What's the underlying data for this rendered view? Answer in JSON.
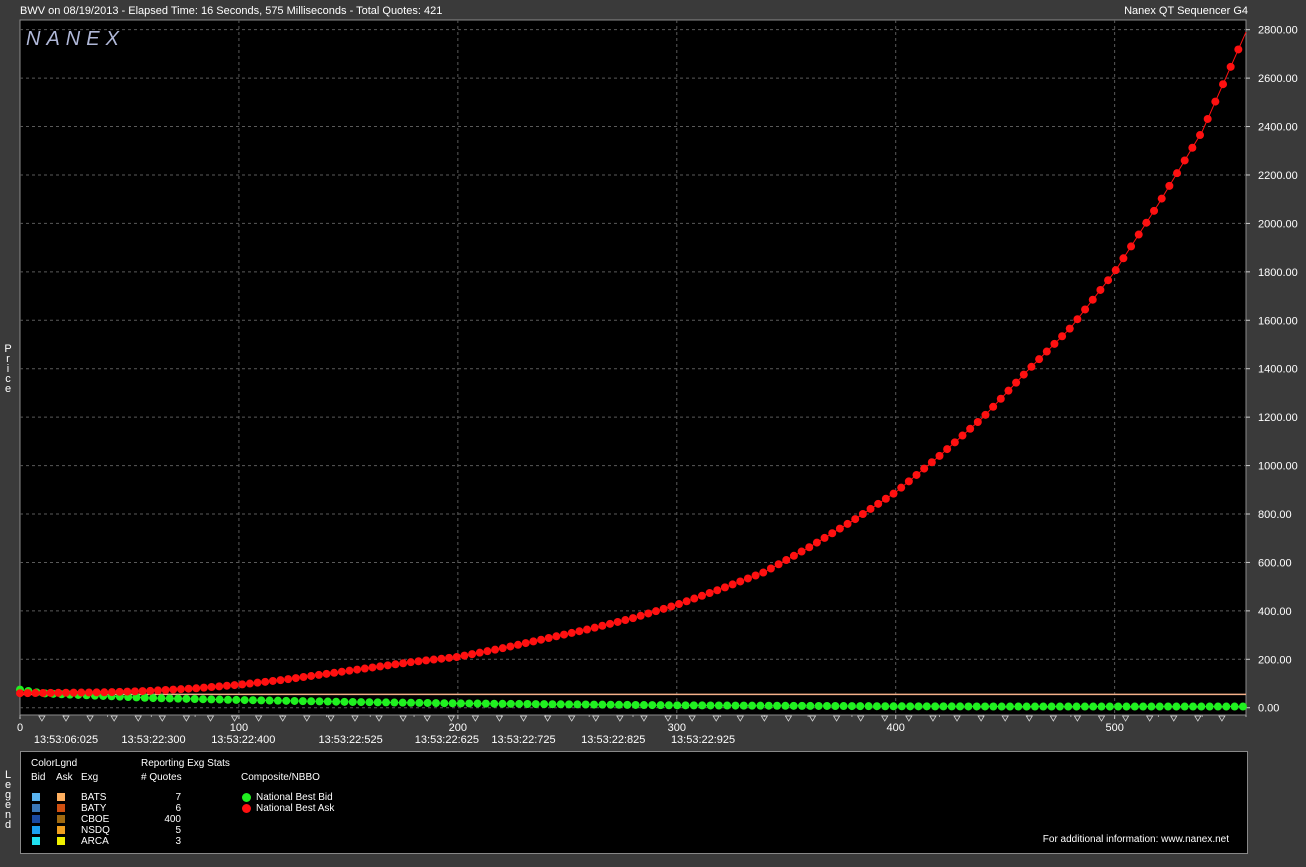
{
  "header": {
    "title": "BWV on 08/19/2013  -  Elapsed Time: 16 Seconds, 575 Milliseconds  -  Total Quotes: 421",
    "app_name": "Nanex QT Sequencer G4"
  },
  "watermark": "NANEX",
  "y_axis_label": "Price",
  "legend_side_label": "Legend",
  "chart_data": {
    "type": "scatter",
    "xlim": [
      0,
      560
    ],
    "ylim": [
      -30,
      2840
    ],
    "y_ticks": [
      0,
      200,
      400,
      600,
      800,
      1000,
      1200,
      1400,
      1600,
      1800,
      2000,
      2200,
      2400,
      2600,
      2800
    ],
    "y_tick_labels": [
      "0.00",
      "200.00",
      "400.00",
      "600.00",
      "800.00",
      "1000.00",
      "1200.00",
      "1400.00",
      "1600.00",
      "1800.00",
      "2000.00",
      "2200.00",
      "2400.00",
      "2600.00",
      "2800.00"
    ],
    "x_ticks": [
      0,
      100,
      200,
      300,
      400,
      500
    ],
    "x_tick_labels": [
      "0",
      "100",
      "200",
      "300",
      "400",
      "500"
    ],
    "time_labels": [
      {
        "x": 21,
        "label": "13:53:06:025"
      },
      {
        "x": 61,
        "label": "13:53:22:300"
      },
      {
        "x": 102,
        "label": "13:53:22:400"
      },
      {
        "x": 151,
        "label": "13:53:22:525"
      },
      {
        "x": 195,
        "label": "13:53:22:625"
      },
      {
        "x": 230,
        "label": "13:53:22:725"
      },
      {
        "x": 271,
        "label": "13:53:22:825"
      },
      {
        "x": 312,
        "label": "13:53:22:925"
      }
    ],
    "grid": true,
    "series": [
      {
        "name": "National Best Ask",
        "color": "#ff1010",
        "x": [
          0,
          20,
          40,
          60,
          80,
          100,
          120,
          140,
          160,
          180,
          200,
          220,
          240,
          260,
          280,
          300,
          320,
          340,
          360,
          380,
          400,
          420,
          440,
          460,
          480,
          500,
          520,
          540,
          560
        ],
        "y": [
          60,
          62,
          64,
          70,
          80,
          95,
          115,
          140,
          165,
          190,
          210,
          245,
          285,
          325,
          370,
          425,
          490,
          560,
          660,
          770,
          890,
          1040,
          1200,
          1390,
          1570,
          1800,
          2080,
          2380,
          2790
        ]
      },
      {
        "name": "National Best Bid",
        "color": "#20f020",
        "x": [
          0,
          10,
          20,
          40,
          60,
          80,
          100,
          150,
          200,
          250,
          300,
          350,
          400,
          450,
          500,
          560
        ],
        "y": [
          75,
          60,
          55,
          48,
          40,
          36,
          32,
          24,
          18,
          14,
          10,
          8,
          6,
          5,
          5,
          5
        ]
      },
      {
        "name": "CBOE",
        "color": "#f4b08a",
        "x": [
          0,
          560
        ],
        "y": [
          55,
          55
        ]
      }
    ]
  },
  "legend": {
    "color_legend_title": "ColorLgnd",
    "col_bid": "Bid",
    "col_ask": "Ask",
    "col_exg": "Exg",
    "reporting_title": "Reporting Exg Stats",
    "col_quotes": "# Quotes",
    "composite_title": "Composite/NBBO",
    "exchanges": [
      {
        "name": "BATS",
        "quotes": "7",
        "bid_color": "#5ab4f0",
        "ask_color": "#ffb060"
      },
      {
        "name": "BATY",
        "quotes": "6",
        "bid_color": "#3a78b8",
        "ask_color": "#d05010"
      },
      {
        "name": "CBOE",
        "quotes": "400",
        "bid_color": "#1a4aa0",
        "ask_color": "#a06a10"
      },
      {
        "name": "NSDQ",
        "quotes": "5",
        "bid_color": "#1aa0f0",
        "ask_color": "#f0a020"
      },
      {
        "name": "ARCA",
        "quotes": "3",
        "bid_color": "#20e0f0",
        "ask_color": "#f0f000"
      }
    ],
    "nbbo": [
      {
        "label": "National Best Bid",
        "color": "#20f020"
      },
      {
        "label": "National Best Ask",
        "color": "#ff1010"
      }
    ],
    "footer": "For additional information: www.nanex.net"
  }
}
